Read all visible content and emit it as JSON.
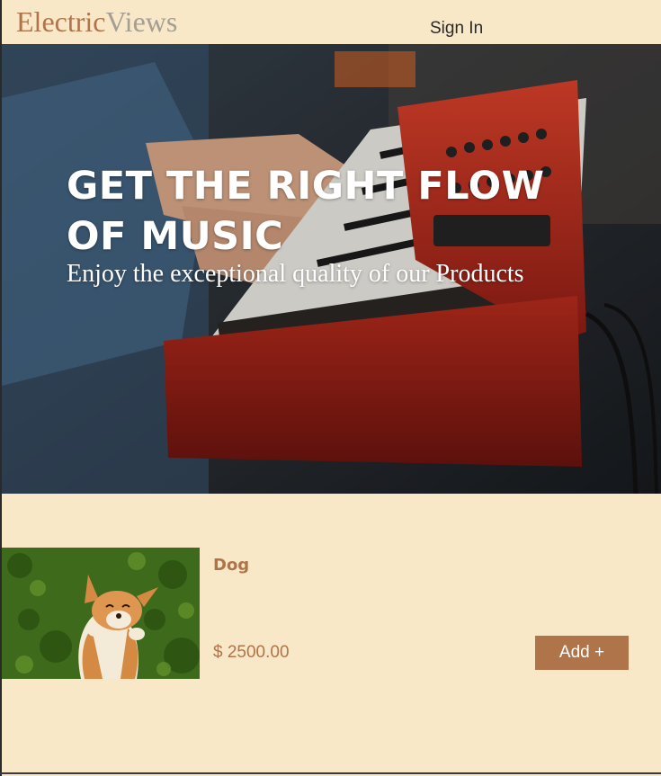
{
  "brand": {
    "part1": "Electric",
    "part2": "Views"
  },
  "nav": {
    "signin_label": "Sign In"
  },
  "hero": {
    "title": "GET THE RIGHT FLOW OF MUSIC",
    "subtitle": "Enjoy the exceptional quality of our Products"
  },
  "product": {
    "name": "Dog",
    "price": "$ 2500.00",
    "add_label": "Add +"
  },
  "colors": {
    "background": "#f9e8c8",
    "accent": "#b0744a",
    "brand_secondary": "#a49e93"
  }
}
